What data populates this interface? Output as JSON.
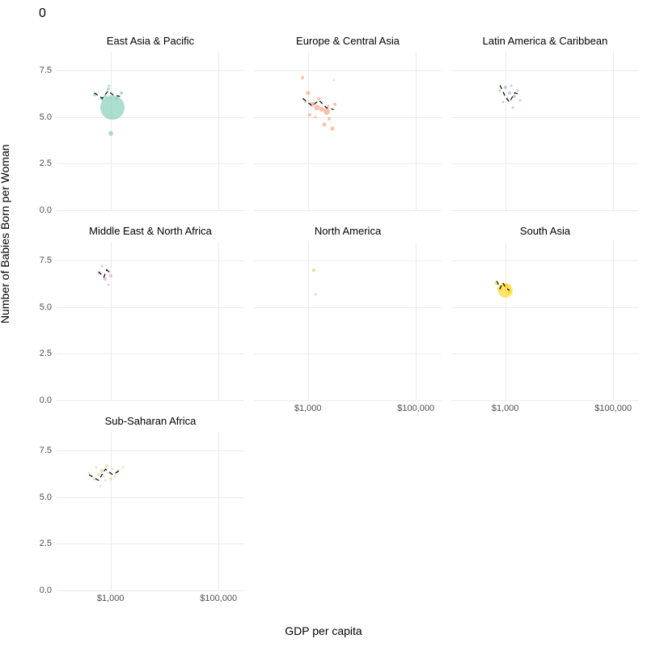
{
  "title": "0",
  "xlabel": "GDP per capita",
  "ylabel": "Number of Babies Born per Woman",
  "xticks": [
    "$1,000",
    "$100,000"
  ],
  "yticks": [
    "0.0",
    "2.5",
    "5.0",
    "7.5"
  ],
  "facets": [
    "East Asia & Pacific",
    "Europe & Central Asia",
    "Latin America & Caribbean",
    "Middle East & North Africa",
    "North America",
    "South Asia",
    "Sub-Saharan Africa"
  ],
  "chart_data": {
    "type": "scatter",
    "xlabel": "GDP per capita",
    "ylabel": "Number of Babies Born per Woman",
    "x_scale": "log10",
    "xlim": [
      100,
      300000
    ],
    "ylim": [
      0,
      8.5
    ],
    "size_encodes": "population",
    "facets": [
      {
        "name": "East Asia & Pacific",
        "color": "#66c2a5",
        "points": [
          {
            "gdp": 500,
            "fert": 6.2,
            "size": 4
          },
          {
            "gdp": 700,
            "fert": 6.0,
            "size": 5
          },
          {
            "gdp": 800,
            "fert": 6.1,
            "size": 4
          },
          {
            "gdp": 900,
            "fert": 6.5,
            "size": 4
          },
          {
            "gdp": 950,
            "fert": 6.7,
            "size": 3
          },
          {
            "gdp": 1000,
            "fert": 4.1,
            "size": 6
          },
          {
            "gdp": 1100,
            "fert": 5.5,
            "size": 30
          },
          {
            "gdp": 1300,
            "fert": 6.0,
            "size": 3
          },
          {
            "gdp": 1600,
            "fert": 6.3,
            "size": 4
          }
        ],
        "trend": [
          [
            500,
            6.3
          ],
          [
            700,
            6.0
          ],
          [
            900,
            6.4
          ],
          [
            1100,
            6.2
          ],
          [
            1500,
            6.1
          ]
        ]
      },
      {
        "name": "Europe & Central Asia",
        "color": "#fc8d62",
        "points": [
          {
            "gdp": 800,
            "fert": 7.1,
            "size": 4
          },
          {
            "gdp": 900,
            "fert": 5.8,
            "size": 3
          },
          {
            "gdp": 1000,
            "fert": 6.3,
            "size": 5
          },
          {
            "gdp": 1100,
            "fert": 5.1,
            "size": 4
          },
          {
            "gdp": 1200,
            "fert": 5.7,
            "size": 6
          },
          {
            "gdp": 1400,
            "fert": 5.0,
            "size": 3
          },
          {
            "gdp": 1500,
            "fert": 5.5,
            "size": 7
          },
          {
            "gdp": 1600,
            "fert": 6.0,
            "size": 4
          },
          {
            "gdp": 1800,
            "fert": 5.4,
            "size": 6
          },
          {
            "gdp": 2000,
            "fert": 4.6,
            "size": 5
          },
          {
            "gdp": 2200,
            "fert": 5.3,
            "size": 8
          },
          {
            "gdp": 2400,
            "fert": 5.6,
            "size": 3
          },
          {
            "gdp": 2500,
            "fert": 4.9,
            "size": 4
          },
          {
            "gdp": 2800,
            "fert": 4.4,
            "size": 5
          },
          {
            "gdp": 3000,
            "fert": 7.0,
            "size": 2
          },
          {
            "gdp": 3200,
            "fert": 5.7,
            "size": 4
          }
        ],
        "trend": [
          [
            800,
            6.0
          ],
          [
            1200,
            5.6
          ],
          [
            1600,
            5.9
          ],
          [
            2200,
            5.5
          ],
          [
            3000,
            5.4
          ]
        ]
      },
      {
        "name": "Latin America & Caribbean",
        "color": "#8da0cb",
        "points": [
          {
            "gdp": 800,
            "fert": 6.4,
            "size": 3
          },
          {
            "gdp": 900,
            "fert": 5.8,
            "size": 3
          },
          {
            "gdp": 1000,
            "fert": 6.6,
            "size": 4
          },
          {
            "gdp": 1100,
            "fert": 6.0,
            "size": 3
          },
          {
            "gdp": 1200,
            "fert": 6.3,
            "size": 4
          },
          {
            "gdp": 1300,
            "fert": 6.7,
            "size": 3
          },
          {
            "gdp": 1400,
            "fert": 5.5,
            "size": 3
          },
          {
            "gdp": 1500,
            "fert": 6.1,
            "size": 4
          },
          {
            "gdp": 1700,
            "fert": 6.4,
            "size": 3
          },
          {
            "gdp": 1900,
            "fert": 5.9,
            "size": 3
          }
        ],
        "trend": [
          [
            800,
            6.7
          ],
          [
            1000,
            6.1
          ],
          [
            1200,
            5.8
          ],
          [
            1500,
            6.3
          ],
          [
            1900,
            6.2
          ]
        ]
      },
      {
        "name": "Middle East & North Africa",
        "color": "#e78ac3",
        "points": [
          {
            "gdp": 600,
            "fert": 6.8,
            "size": 3
          },
          {
            "gdp": 700,
            "fert": 7.2,
            "size": 3
          },
          {
            "gdp": 800,
            "fert": 6.5,
            "size": 4
          },
          {
            "gdp": 850,
            "fert": 7.0,
            "size": 3
          },
          {
            "gdp": 900,
            "fert": 6.2,
            "size": 3
          },
          {
            "gdp": 950,
            "fert": 6.9,
            "size": 3
          },
          {
            "gdp": 1000,
            "fert": 6.7,
            "size": 4
          }
        ],
        "trend": [
          [
            600,
            6.9
          ],
          [
            750,
            6.6
          ],
          [
            850,
            7.0
          ],
          [
            1000,
            6.8
          ]
        ]
      },
      {
        "name": "North America",
        "color": "#a6d854",
        "points": [
          {
            "gdp": 1300,
            "fert": 7.0,
            "size": 4
          },
          {
            "gdp": 1400,
            "fert": 5.7,
            "size": 3
          }
        ],
        "trend": []
      },
      {
        "name": "South Asia",
        "color": "#ffd92f",
        "points": [
          {
            "gdp": 700,
            "fert": 6.3,
            "size": 5
          },
          {
            "gdp": 800,
            "fert": 6.0,
            "size": 6
          },
          {
            "gdp": 900,
            "fert": 6.2,
            "size": 4
          },
          {
            "gdp": 1000,
            "fert": 5.9,
            "size": 18
          },
          {
            "gdp": 1100,
            "fert": 6.1,
            "size": 6
          },
          {
            "gdp": 1200,
            "fert": 5.8,
            "size": 5
          }
        ],
        "trend": [
          [
            700,
            6.4
          ],
          [
            800,
            6.0
          ],
          [
            900,
            6.3
          ],
          [
            1050,
            6.0
          ],
          [
            1200,
            5.9
          ]
        ]
      },
      {
        "name": "Sub-Saharan Africa",
        "color": "#e5c494",
        "points": [
          {
            "gdp": 400,
            "fert": 6.3,
            "size": 3
          },
          {
            "gdp": 500,
            "fert": 6.0,
            "size": 4
          },
          {
            "gdp": 550,
            "fert": 6.6,
            "size": 3
          },
          {
            "gdp": 600,
            "fert": 6.2,
            "size": 4
          },
          {
            "gdp": 650,
            "fert": 5.6,
            "size": 3
          },
          {
            "gdp": 700,
            "fert": 6.4,
            "size": 5
          },
          {
            "gdp": 750,
            "fert": 6.1,
            "size": 3
          },
          {
            "gdp": 800,
            "fert": 5.9,
            "size": 3
          },
          {
            "gdp": 850,
            "fert": 6.7,
            "size": 4
          },
          {
            "gdp": 900,
            "fert": 6.3,
            "size": 3
          },
          {
            "gdp": 1000,
            "fert": 6.0,
            "size": 4
          },
          {
            "gdp": 1100,
            "fert": 6.5,
            "size": 3
          },
          {
            "gdp": 1200,
            "fert": 6.1,
            "size": 3
          },
          {
            "gdp": 1400,
            "fert": 6.4,
            "size": 4
          },
          {
            "gdp": 1700,
            "fert": 6.6,
            "size": 3
          }
        ],
        "trend": [
          [
            400,
            6.2
          ],
          [
            600,
            5.9
          ],
          [
            800,
            6.5
          ],
          [
            1100,
            6.2
          ],
          [
            1600,
            6.5
          ]
        ]
      }
    ]
  }
}
